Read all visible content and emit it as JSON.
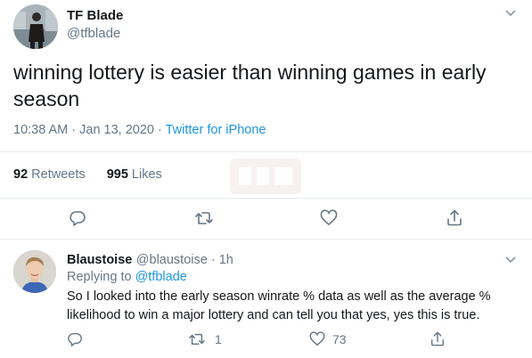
{
  "tweet": {
    "author_name": "TF Blade",
    "author_handle": "@tfblade",
    "text": "winning lottery is easier than winning games in early season",
    "time": "10:38 AM · Jan 13, 2020 · ",
    "source": "Twitter for iPhone",
    "retweets_count": "92",
    "retweets_label": "Retweets",
    "likes_count": "995",
    "likes_label": "Likes"
  },
  "reply": {
    "author_name": "Blaustoise",
    "author_handle": "@blaustoise · 1h",
    "replying_prefix": "Replying to",
    "replying_handle": "@tfblade",
    "text": "So I looked into the early season winrate % data as well as the average % likelihood to win a major lottery and can tell you that yes, yes this is true.",
    "retweet_count": "1",
    "like_count": "73"
  },
  "icons": {
    "reply": "reply-icon",
    "retweet": "retweet-icon",
    "like": "heart-icon",
    "share": "share-icon",
    "menu": "chevron-down-icon"
  },
  "colors": {
    "link": "#1b95e0",
    "secondary_text": "#657786",
    "icon": "#657786",
    "divider": "#e6ecf0"
  }
}
